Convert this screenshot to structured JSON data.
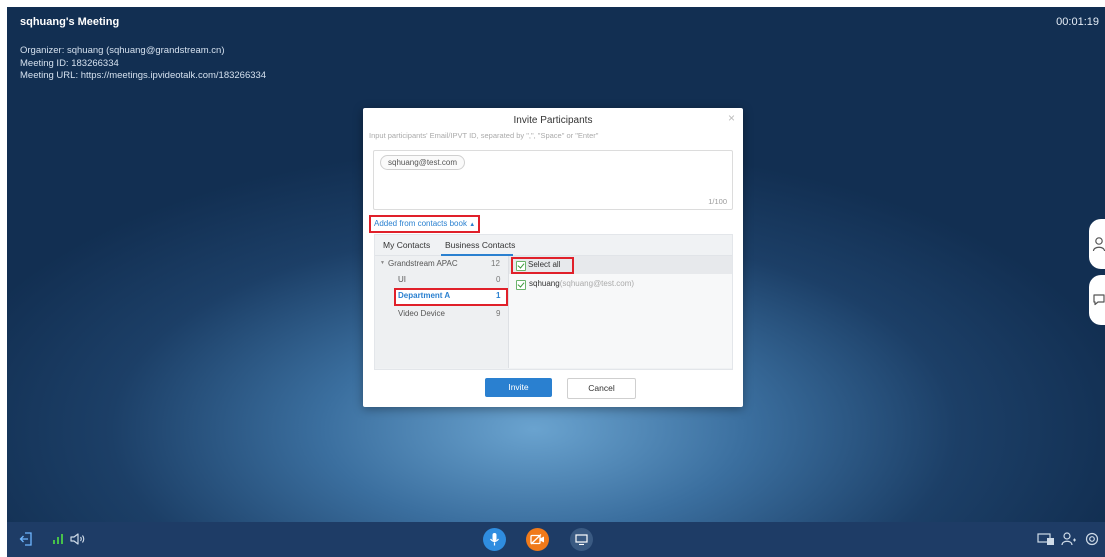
{
  "meeting": {
    "title": "sqhuang's Meeting",
    "elapsed": "00:01:19",
    "organizer": "Organizer: sqhuang (sqhuang@grandstream.cn)",
    "meeting_id": "Meeting ID: 183266334",
    "meeting_url": "Meeting URL: https://meetings.ipvideotalk.com/183266334"
  },
  "dialog": {
    "title": "Invite Participants",
    "close": "×",
    "hint": "Input participants' Email/IPVT ID, separated by \",\", \"Space\" or \"Enter\"",
    "chip": "sqhuang@test.com",
    "counter": "1/100",
    "contacts_toggle": "Added from contacts book",
    "tabs": [
      "My Contacts",
      "Business Contacts"
    ],
    "tree": {
      "root": {
        "label": "Grandstream APAC",
        "count": "12"
      },
      "children": [
        {
          "label": "UI",
          "count": "0"
        },
        {
          "label": "Department A",
          "count": "1"
        },
        {
          "label": "Video Device",
          "count": "9"
        }
      ]
    },
    "list": {
      "select_all": "Select all",
      "members": [
        {
          "name": "sqhuang",
          "email": "(sqhuang@test.com)"
        }
      ]
    },
    "buttons": {
      "invite": "Invite",
      "cancel": "Cancel"
    }
  },
  "colors": {
    "accent": "#2a80d0",
    "highlight": "#e0202a",
    "bar": "#1e3c66",
    "video_button": "#f07a1a"
  },
  "toolbar_icons": [
    "leave-icon",
    "signal-icon",
    "speaker-icon",
    "microphone-icon",
    "video-off-icon",
    "screen-share-icon",
    "display-icon",
    "participants-icon",
    "settings-icon"
  ]
}
